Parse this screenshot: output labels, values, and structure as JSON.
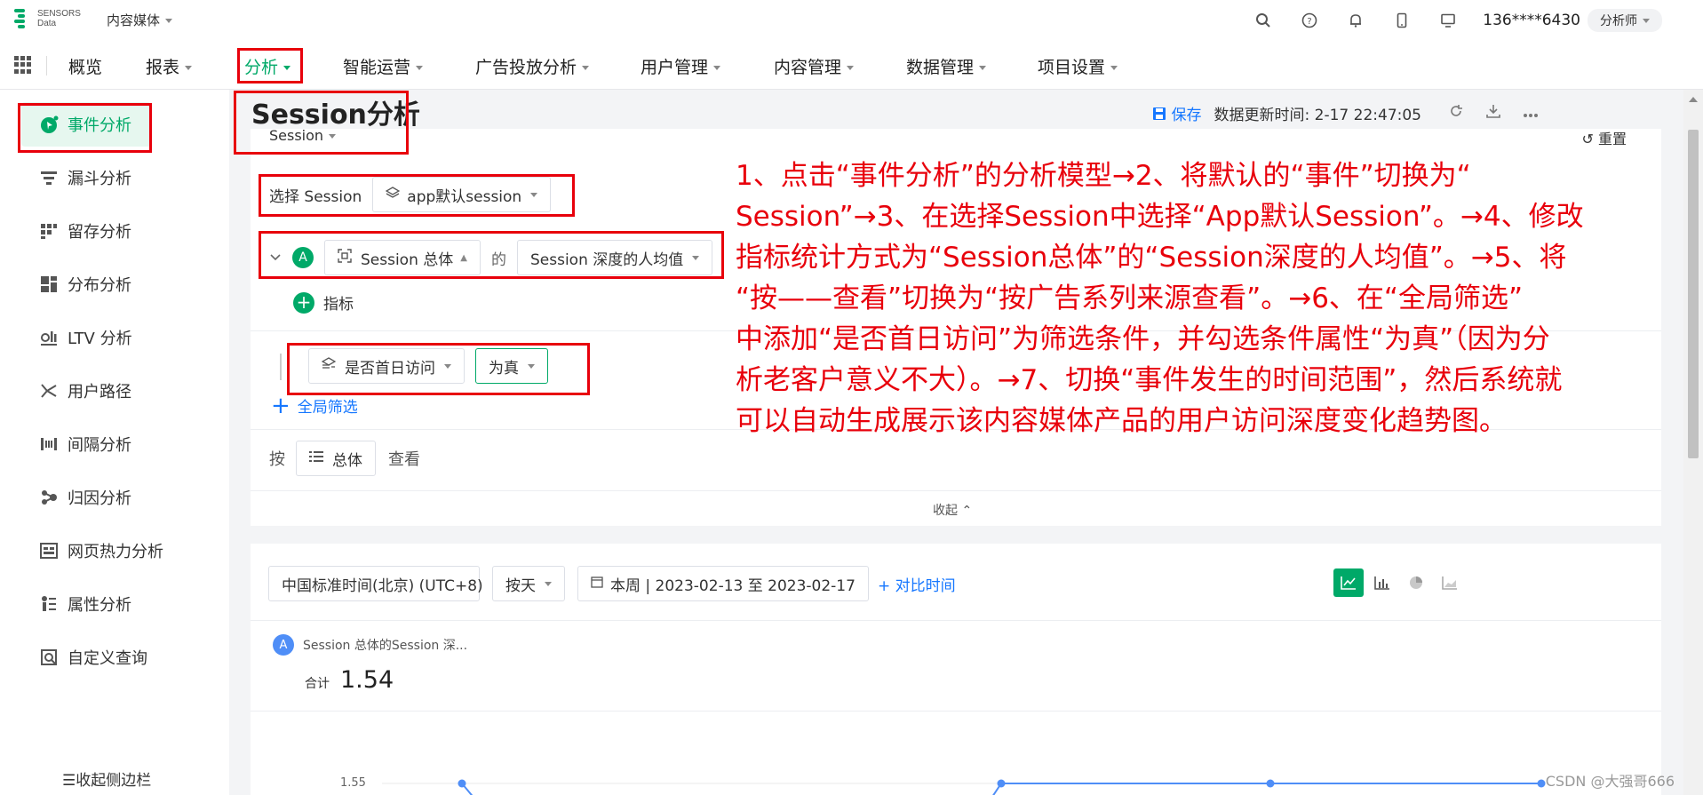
{
  "topbar": {
    "logo_line1": "SENSORS",
    "logo_line2": "Data",
    "project": "内容媒体",
    "icons": [
      "search-icon",
      "help-icon",
      "bell-icon",
      "mobile-icon",
      "monitor-icon"
    ],
    "user": "136****6430",
    "role": "分析师"
  },
  "nav": {
    "items": [
      {
        "label": "概览"
      },
      {
        "label": "报表"
      },
      {
        "label": "分析"
      },
      {
        "label": "智能运营"
      },
      {
        "label": "广告投放分析"
      },
      {
        "label": "用户管理"
      },
      {
        "label": "内容管理"
      },
      {
        "label": "数据管理"
      },
      {
        "label": "项目设置"
      }
    ],
    "active": "分析"
  },
  "sidebar": {
    "items": [
      {
        "label": "事件分析",
        "icon": "event-analysis-icon"
      },
      {
        "label": "漏斗分析",
        "icon": "funnel-icon"
      },
      {
        "label": "留存分析",
        "icon": "retention-icon"
      },
      {
        "label": "分布分析",
        "icon": "distribution-icon"
      },
      {
        "label": "LTV 分析",
        "icon": "ltv-icon"
      },
      {
        "label": "用户路径",
        "icon": "user-path-icon"
      },
      {
        "label": "间隔分析",
        "icon": "interval-icon"
      },
      {
        "label": "归因分析",
        "icon": "attribution-icon"
      },
      {
        "label": "网页热力分析",
        "icon": "heatmap-icon"
      },
      {
        "label": "属性分析",
        "icon": "attribute-icon"
      },
      {
        "label": "自定义查询",
        "icon": "custom-query-icon"
      }
    ],
    "collapse_label": "收起侧边栏"
  },
  "header": {
    "title": "Session分析",
    "session_dropdown": "Session",
    "save_label": "保存",
    "update_time": "数据更新时间: 2-17 22:47:05",
    "reset_label": "重置"
  },
  "query": {
    "select_session_label": "选择 Session",
    "session_value": "app默认session",
    "metric_badge": "A",
    "metric_scope": "Session 总体",
    "of_label": "的",
    "metric_value": "Session 深度的人均值",
    "add_metric_label": "指标",
    "filter_property": "是否首日访问",
    "filter_condition": "为真",
    "global_filter_label": "全局筛选",
    "by_label": "按",
    "group_value": "总体",
    "view_label": "查看",
    "collapse_label": "收起"
  },
  "chart_toolbar": {
    "timezone": "中国标准时间(北京) (UTC+8)",
    "granularity": "按天",
    "date_range": "本周 | 2023-02-13 至 2023-02-17",
    "compare_label": "对比时间",
    "chart_types": [
      "line-chart-icon",
      "bar-chart-icon",
      "pie-chart-icon",
      "area-chart-icon"
    ]
  },
  "result": {
    "series_badge": "A",
    "series_name": "Session 总体的Session 深...",
    "total_label": "合计",
    "total_value": "1.54",
    "y_tick": "1.55"
  },
  "annotation": {
    "text": "1、点击“事件分析”的分析模型→2、将默认的“事件”切换为“\nSession”→3、在选择Session中选择“App默认Session”。→4、修改\n指标统计方式为“Session总体”的“Session深度的人均值”。→5、将\n“按——查看”切换为“按广告系列来源查看”。→6、在“全局筛选”\n中添加“是否首日访问”为筛选条件，并勾选条件属性“为真”（因为分\n析老客户意义不大）。→7、切换“事件发生的时间范围”，然后系统就\n可以自动生成展示该内容媒体产品的用户访问深度变化趋势图。",
    "color": "#e8000b"
  },
  "watermark": "CSDN @大强哥666",
  "colors": {
    "accent": "#00a968",
    "link": "#1677ff",
    "annotation": "#e8000b"
  }
}
